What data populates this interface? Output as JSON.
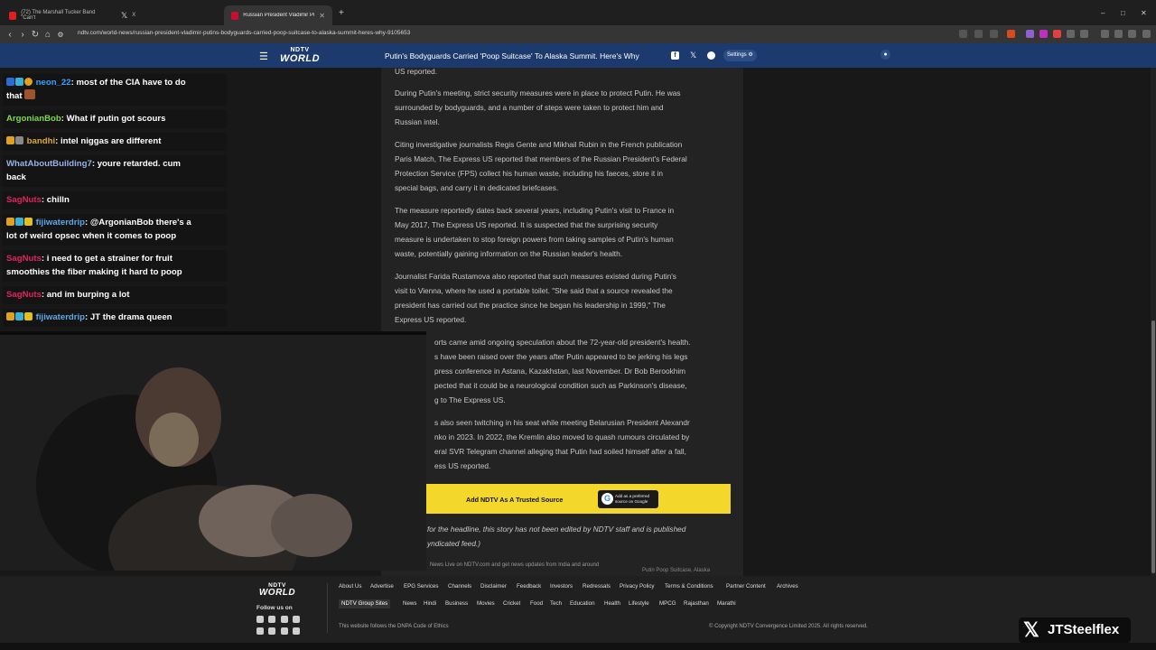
{
  "browser": {
    "tabs": [
      {
        "title": "(72) The Marshall Tucker Band \"Can't",
        "active": false
      },
      {
        "title": "X",
        "active": false
      },
      {
        "title": "Russian President Vladimir Putin",
        "active": true
      }
    ],
    "new_tab": "+",
    "window_controls": [
      "–",
      "□",
      "✕"
    ],
    "url": "ndtv.com/world-news/russian-president-vladimir-putins-bodyguards-carried-poop-suitcase-to-alaska-summit-heres-why-9105653"
  },
  "site_header": {
    "logo_top": "NDTV",
    "logo_bottom": "WORLD",
    "headline": "Putin's Bodyguards Carried 'Poop Suitcase' To Alaska Summit. Here's Why",
    "settings_label": "Settings"
  },
  "article": {
    "top_fragment": "US reported.",
    "paragraphs": [
      [
        "During Putin's meeting, strict security measures were in place to protect Putin. He was",
        "surrounded by bodyguards, and a number of steps were taken to protect him and",
        "Russian intel."
      ],
      [
        "Citing investigative journalists Regis Gente and Mikhail Rubin in the French publication",
        "Paris Match, The Express US reported that members of the Russian President's Federal",
        "Protection Service (FPS) collect his human waste, including his faeces, store it in",
        "special bags, and carry it in dedicated briefcases."
      ],
      [
        "The measure reportedly dates back several years, including Putin's visit to France in",
        "May 2017, The Express US reported. It is suspected that the surprising security",
        "measure is undertaken to stop foreign powers from taking samples of Putin's human",
        "waste, potentially gaining information on the Russian leader's health."
      ],
      [
        "Journalist Farida Rustamova also reported that such measures existed during Putin's",
        "visit to Vienna, where he used a portable toilet. \"She said that a source revealed the",
        "president has carried out the practice since he began his leadership in 1999,\" The",
        "Express US reported."
      ],
      [
        "orts came amid ongoing speculation about the 72-year-old president's health.",
        "s have been raised over the years after Putin appeared to be jerking his legs",
        "press conference in Astana, Kazakhstan, last November. Dr Bob Berookhim",
        "pected that it could be a neurological condition such as Parkinson's disease,",
        "g to The Express US."
      ],
      [
        "s also seen twitching in his seat while meeting Belarusian President Alexandr",
        "nko in 2023. In 2022, the Kremlin also moved to quash rumours circulated by",
        "eral SVR Telegram channel alleging that Putin had soiled himself after a fall,",
        "ess US reported."
      ]
    ],
    "cta_label": "Add NDTV As A Trusted Source",
    "cta_google_line1": "Add as a preferred",
    "cta_google_line2": "source on Google",
    "disclaimer_line1": "for the headline, this story has not been edited by NDTV staff and is published",
    "disclaimer_line2": "yndicated feed.)",
    "live_text": "News Live on NDTV.com and get news updates from India and around",
    "tag_text": "Putin Poop Suitcase, Alaska"
  },
  "footer": {
    "logo_top": "NDTV",
    "logo_bottom": "WORLD",
    "follow_label": "Follow us on",
    "links_row1": [
      "About Us",
      "Advertise",
      "EPG Services",
      "Channels",
      "Disclaimer",
      "Feedback",
      "Investors",
      "Redressals",
      "Privacy Policy",
      "Terms & Conditions",
      "Partner Content",
      "Archives"
    ],
    "group_sites_label": "NDTV Group Sites",
    "links_row2": [
      "News",
      "Hindi",
      "Business",
      "Movies",
      "Cricket",
      "Food",
      "Tech",
      "Education",
      "Health",
      "Lifestyle",
      "MPCG",
      "Rajasthan",
      "Marathi"
    ],
    "ethics": "This website follows the DNPA Code of Ethics",
    "copyright": "© Copyright NDTV Convergence Limited 2025. All rights reserved."
  },
  "chat": [
    {
      "user": "neon_22",
      "color": "#3aa0ff",
      "lines": [
        ": most of the CIA have to do",
        "that"
      ],
      "badges": [
        "#2b6bd6",
        "#3ab0d6",
        "#e0a020"
      ]
    },
    {
      "user": "ArgonianBob",
      "color": "#7dd84a",
      "lines": [
        ": What if putin got scours"
      ],
      "badges": []
    },
    {
      "user": "bandhi",
      "color": "#e0a838",
      "lines": [
        ": intel niggas are different"
      ],
      "badges": [
        "#e0a020",
        "#888888"
      ]
    },
    {
      "user": "WhatAboutBuilding7",
      "color": "#9ab0e6",
      "lines": [
        ": youre retarded. cum",
        "back"
      ],
      "badges": []
    },
    {
      "user": "SagNuts",
      "color": "#e0245e",
      "lines": [
        ": chilln"
      ],
      "badges": []
    },
    {
      "user": "fijiwaterdrip",
      "color": "#5fa8e8",
      "lines": [
        ": @ArgonianBob there's a",
        "lot of weird opsec when it comes to poop"
      ],
      "badges": [
        "#e0a020",
        "#3ab0d6",
        "#e0c020"
      ]
    },
    {
      "user": "SagNuts",
      "color": "#e0245e",
      "lines": [
        ": i need to get a strainer for fruit",
        "smoothies the fiber making it hard to poop"
      ],
      "badges": []
    },
    {
      "user": "SagNuts",
      "color": "#e0245e",
      "lines": [
        ": and im burping a lot"
      ],
      "badges": []
    },
    {
      "user": "fijiwaterdrip",
      "color": "#5fa8e8",
      "lines": [
        ": JT the drama queen"
      ],
      "badges": [
        "#e0a020",
        "#3ab0d6",
        "#e0c020"
      ]
    }
  ],
  "watermark": "JTSteelflex"
}
